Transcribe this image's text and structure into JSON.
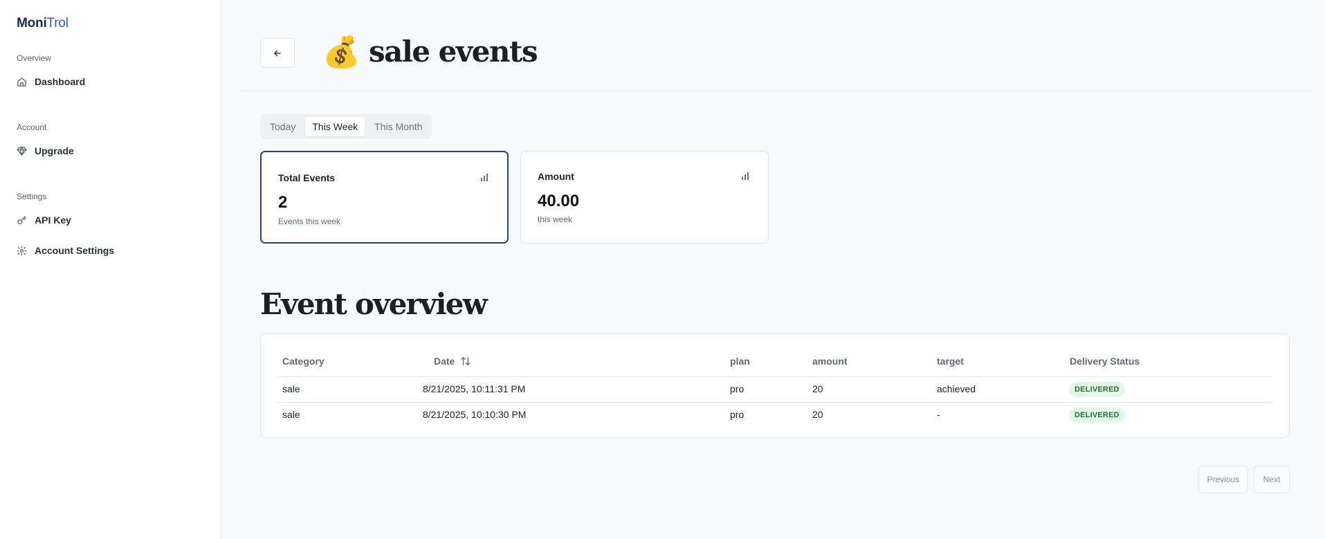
{
  "app": {
    "logo_part1": "Moni",
    "logo_part2": "Trol"
  },
  "sidebar": {
    "sections": [
      {
        "title": "Overview",
        "items": [
          {
            "label": "Dashboard",
            "icon": "home-icon"
          }
        ]
      },
      {
        "title": "Account",
        "items": [
          {
            "label": "Upgrade",
            "icon": "gem-icon"
          }
        ]
      },
      {
        "title": "Settings",
        "items": [
          {
            "label": "API Key",
            "icon": "key-icon"
          },
          {
            "label": "Account Settings",
            "icon": "gear-icon"
          }
        ]
      }
    ]
  },
  "header": {
    "emoji": "💰",
    "title": "sale events",
    "back_icon": "arrow-left-icon"
  },
  "range_tabs": {
    "items": [
      "Today",
      "This Week",
      "This Month"
    ],
    "active": "This Week"
  },
  "stats": [
    {
      "title": "Total Events",
      "value": "2",
      "sub": "Events this week",
      "icon": "bar-chart-icon"
    },
    {
      "title": "Amount",
      "value": "40.00",
      "sub": "this week",
      "icon": "bar-chart-icon"
    }
  ],
  "events": {
    "title": "Event overview",
    "columns": [
      "Category",
      "Date",
      "plan",
      "amount",
      "target",
      "Delivery Status"
    ],
    "rows": [
      [
        "sale",
        "8/21/2025, 10:11:31 PM",
        "pro",
        "20",
        "achieved",
        "DELIVERED"
      ],
      [
        "sale",
        "8/21/2025, 10:10:30 PM",
        "pro",
        "20",
        "-",
        "DELIVERED"
      ]
    ],
    "sort_icon": "sort-arrows-icon"
  },
  "pagination": {
    "previous": "Previous",
    "next": "Next"
  },
  "colors": {
    "accent": "#2f56c8",
    "selected_border": "#2a3f86",
    "badge_bg": "#e4f6e7",
    "badge_text": "#23713a"
  }
}
